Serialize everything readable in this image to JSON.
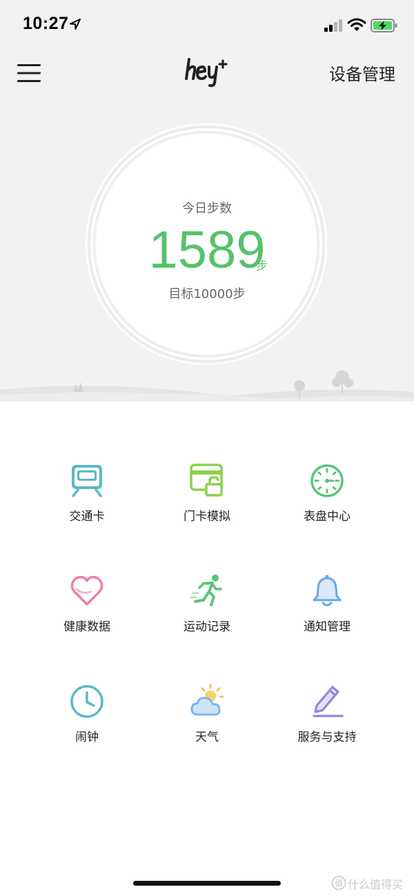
{
  "status_bar": {
    "time": "10:27"
  },
  "nav": {
    "logo": "hey+",
    "right_action": "设备管理"
  },
  "steps": {
    "title": "今日步数",
    "value": "1589",
    "unit": "步",
    "goal": "目标10000步"
  },
  "features": [
    {
      "label": "交通卡",
      "icon": "train-icon",
      "color": "#5cb8c6"
    },
    {
      "label": "门卡模拟",
      "icon": "access-card-icon",
      "color": "#8ccf4e"
    },
    {
      "label": "表盘中心",
      "icon": "watch-face-icon",
      "color": "#5cc27a"
    },
    {
      "label": "健康数据",
      "icon": "heart-icon",
      "color": "#ef7f9c"
    },
    {
      "label": "运动记录",
      "icon": "running-icon",
      "color": "#5cc27a"
    },
    {
      "label": "通知管理",
      "icon": "bell-icon",
      "color": "#6aa6e6"
    },
    {
      "label": "闹钟",
      "icon": "clock-icon",
      "color": "#5cb8c6"
    },
    {
      "label": "天气",
      "icon": "weather-icon",
      "color": "#7bb8ea"
    },
    {
      "label": "服务与支持",
      "icon": "edit-pencil-icon",
      "color": "#8f86e0"
    }
  ],
  "watermark": {
    "text": "什么值得买"
  }
}
